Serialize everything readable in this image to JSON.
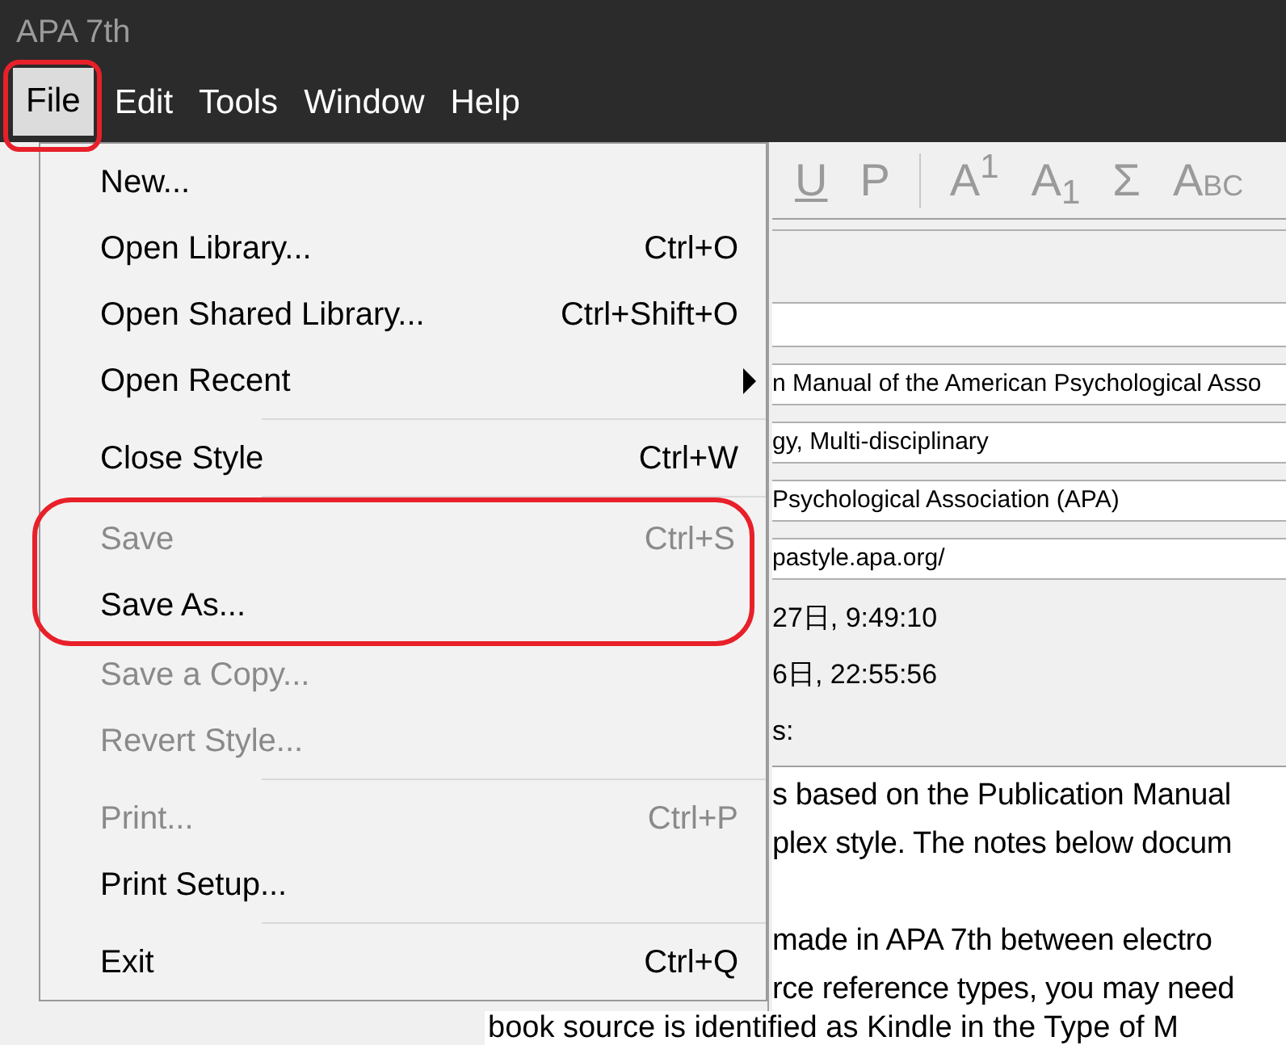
{
  "window": {
    "title": "APA 7th"
  },
  "menu_bar": [
    {
      "label": "File",
      "selected": true,
      "circled": true
    },
    {
      "label": "Edit",
      "selected": false
    },
    {
      "label": "Tools",
      "selected": false
    },
    {
      "label": "Window",
      "selected": false
    },
    {
      "label": "Help",
      "selected": false
    }
  ],
  "toolbar": [
    {
      "kind": "underline",
      "label": "U"
    },
    {
      "kind": "plain",
      "label": "P"
    },
    {
      "kind": "separator"
    },
    {
      "kind": "plain",
      "label": "A$^{1}$"
    },
    {
      "kind": "plain",
      "label": "A$_{1}$"
    },
    {
      "kind": "plain",
      "label": "Σ"
    },
    {
      "kind": "smallcaps",
      "label": "A",
      "small": "BC"
    }
  ],
  "file_menu": [
    {
      "kind": "item",
      "label": "New...",
      "disabled": false
    },
    {
      "kind": "item",
      "label": "Open Library...",
      "shortcut": "Ctrl+O",
      "disabled": false
    },
    {
      "kind": "item",
      "label": "Open Shared Library...",
      "shortcut": "Ctrl+Shift+O",
      "disabled": false
    },
    {
      "kind": "submenu",
      "label": "Open Recent",
      "disabled": false
    },
    {
      "kind": "separator"
    },
    {
      "kind": "item",
      "label": "Close Style",
      "shortcut": "Ctrl+W",
      "disabled": false
    },
    {
      "kind": "separator"
    },
    {
      "kind": "item",
      "label": "Save",
      "shortcut": "Ctrl+S",
      "disabled": true,
      "circled": true
    },
    {
      "kind": "item",
      "label": "Save As...",
      "disabled": false,
      "circled": true
    },
    {
      "kind": "item",
      "label": "Save a Copy...",
      "disabled": true
    },
    {
      "kind": "item",
      "label": "Revert Style...",
      "disabled": true
    },
    {
      "kind": "separator"
    },
    {
      "kind": "item",
      "label": "Print...",
      "shortcut": "Ctrl+P",
      "disabled": true
    },
    {
      "kind": "item",
      "label": "Print Setup...",
      "disabled": false
    },
    {
      "kind": "separator"
    },
    {
      "kind": "item",
      "label": "Exit",
      "shortcut": "Ctrl+Q",
      "disabled": false
    }
  ],
  "fields": [
    "n Manual of the American Psychological Asso",
    "gy, Multi-disciplinary",
    " Psychological Association (APA)",
    "pastyle.apa.org/"
  ],
  "info_lines": [
    "27日, 9:49:10",
    "6日, 22:55:56",
    "s:"
  ],
  "notes_paragraphs": [
    {
      "lines": [
        "s based on the Publication Manual",
        "plex style. The notes below docum"
      ]
    },
    {
      "lines": [
        "made in APA 7th between electro",
        "rce reference types, you may need"
      ]
    }
  ],
  "bottom_line": "book source is identified as Kindle in the Type of M"
}
